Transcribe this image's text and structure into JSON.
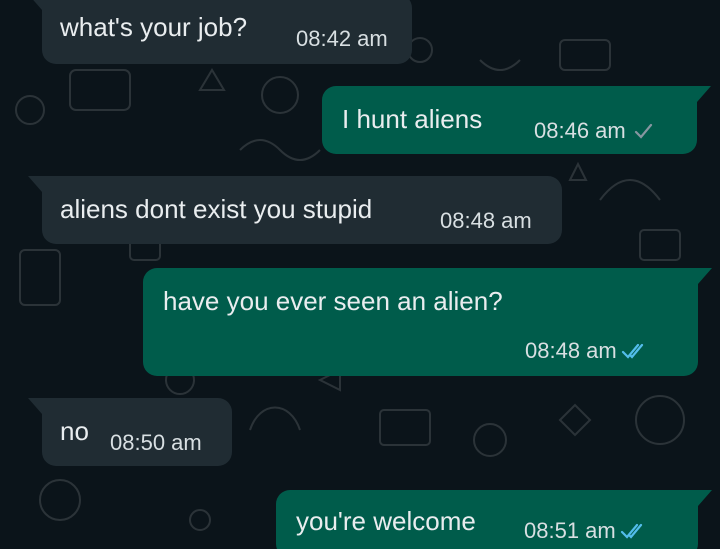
{
  "theme": {
    "background": "#0b141a",
    "incoming_bubble": "#202c33",
    "outgoing_bubble": "#005c4b",
    "sent_tick_color": "#8696a0",
    "read_tick_color": "#53bdeb"
  },
  "messages": [
    {
      "direction": "incoming",
      "text": "what's your job?",
      "time": "08:42 am"
    },
    {
      "direction": "outgoing",
      "text": "I hunt aliens",
      "time": "08:46 am",
      "status": "sent",
      "status_icon": "single-check-icon"
    },
    {
      "direction": "incoming",
      "text": "aliens dont exist you stupid",
      "time": "08:48 am"
    },
    {
      "direction": "outgoing",
      "text": "have you ever seen an alien?",
      "time": "08:48 am",
      "status": "read",
      "status_icon": "double-check-icon"
    },
    {
      "direction": "incoming",
      "text": "no",
      "time": "08:50 am"
    },
    {
      "direction": "outgoing",
      "text": "you're welcome",
      "time": "08:51 am",
      "status": "read",
      "status_icon": "double-check-icon"
    }
  ]
}
